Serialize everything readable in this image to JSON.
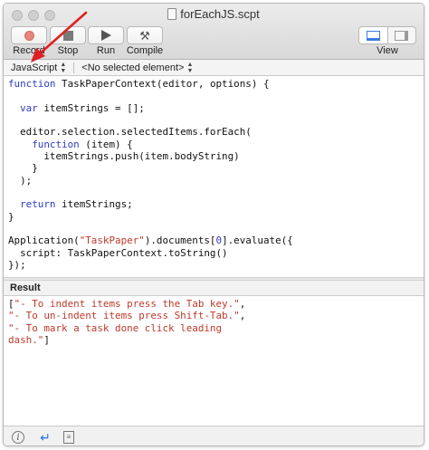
{
  "window": {
    "title": "forEachJS.scpt"
  },
  "toolbar": {
    "record_label": "Record",
    "stop_label": "Stop",
    "run_label": "Run",
    "compile_label": "Compile",
    "view_label": "View",
    "record_icon": "record-dot-icon",
    "stop_icon": "stop-square-icon",
    "run_icon": "play-icon",
    "compile_icon": "hammer-icon"
  },
  "navbar": {
    "language": "JavaScript",
    "element": "<No selected element>"
  },
  "editor": {
    "lines": [
      [
        {
          "t": "function",
          "c": "kw"
        },
        {
          "t": " TaskPaperContext(editor, options) {",
          "c": "plain"
        }
      ],
      [
        {
          "t": "",
          "c": "plain"
        }
      ],
      [
        {
          "t": "  ",
          "c": "plain"
        },
        {
          "t": "var",
          "c": "kw"
        },
        {
          "t": " itemStrings = [];",
          "c": "plain"
        }
      ],
      [
        {
          "t": "",
          "c": "plain"
        }
      ],
      [
        {
          "t": "  editor.selection.selectedItems.forEach(",
          "c": "plain"
        }
      ],
      [
        {
          "t": "    ",
          "c": "plain"
        },
        {
          "t": "function",
          "c": "kw"
        },
        {
          "t": " (item) {",
          "c": "plain"
        }
      ],
      [
        {
          "t": "      itemStrings.push(item.bodyString)",
          "c": "plain"
        }
      ],
      [
        {
          "t": "    }",
          "c": "plain"
        }
      ],
      [
        {
          "t": "  );",
          "c": "plain"
        }
      ],
      [
        {
          "t": "",
          "c": "plain"
        }
      ],
      [
        {
          "t": "  ",
          "c": "plain"
        },
        {
          "t": "return",
          "c": "kw"
        },
        {
          "t": " itemStrings;",
          "c": "plain"
        }
      ],
      [
        {
          "t": "}",
          "c": "plain"
        }
      ],
      [
        {
          "t": "",
          "c": "plain"
        }
      ],
      [
        {
          "t": "Application(",
          "c": "plain"
        },
        {
          "t": "\"TaskPaper\"",
          "c": "str"
        },
        {
          "t": ").documents[",
          "c": "plain"
        },
        {
          "t": "0",
          "c": "kw"
        },
        {
          "t": "].evaluate({",
          "c": "plain"
        }
      ],
      [
        {
          "t": "  script: TaskPaperContext.toString()",
          "c": "plain"
        }
      ],
      [
        {
          "t": "});",
          "c": "plain"
        }
      ]
    ]
  },
  "result": {
    "header": "Result",
    "lines": [
      [
        {
          "t": "[",
          "c": "bracket"
        },
        {
          "t": "\"- To indent items press the Tab key.\"",
          "c": "str"
        },
        {
          "t": ",",
          "c": "bracket"
        }
      ],
      [
        {
          "t": "\"- To un-indent items press Shift-Tab.\"",
          "c": "str"
        },
        {
          "t": ",",
          "c": "bracket"
        }
      ],
      [
        {
          "t": "\"- To mark a task done click leading",
          "c": "str"
        }
      ],
      [
        {
          "t": "dash.\"",
          "c": "str"
        },
        {
          "t": "]",
          "c": "bracket"
        }
      ]
    ]
  },
  "bottombar": {
    "info_icon": "info-icon",
    "return_icon": "return-arrow-icon",
    "list_icon": "list-icon"
  },
  "colors": {
    "keyword": "#2c3ac4",
    "string": "#c0392b",
    "annotation_arrow": "#e02020"
  }
}
